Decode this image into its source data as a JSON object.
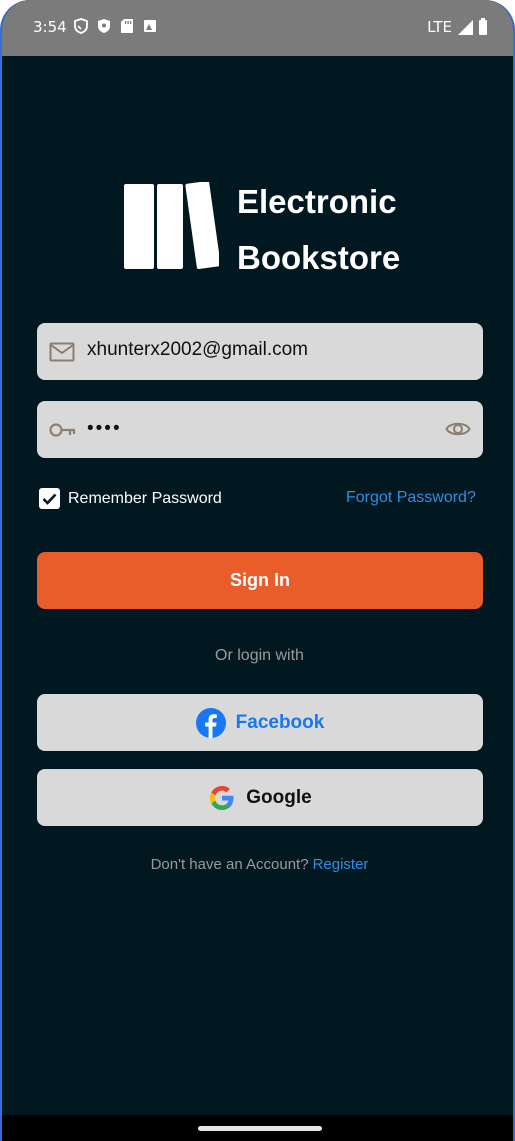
{
  "status_bar": {
    "time": "3:54",
    "network": "LTE",
    "icons": [
      "shield-icon",
      "shield-check-icon",
      "sd-card-icon",
      "image-icon",
      "signal-icon",
      "battery-icon"
    ]
  },
  "brand": {
    "line1": "Electronic",
    "line2": "Bookstore",
    "logo_icon": "books-icon"
  },
  "login_form": {
    "email_value": "xhunterx2002@gmail.com",
    "email_icon": "mail-icon",
    "password_masked": "••••",
    "password_icon": "key-icon",
    "visibility_icon": "eye-icon",
    "remember_label": "Remember Password",
    "remember_checked": true,
    "forgot_label": "Forgot Password?",
    "signin_label": "Sign In"
  },
  "social_login": {
    "divider_text": "Or login with",
    "facebook_label": "Facebook",
    "google_label": "Google"
  },
  "footer": {
    "no_account_text": "Don't have an Account?",
    "register_label": "Register"
  },
  "colors": {
    "background": "#021820",
    "accent": "#e95d2a",
    "link": "#2b8fe6",
    "field": "#d9d9d9",
    "facebook": "#1877f2"
  }
}
